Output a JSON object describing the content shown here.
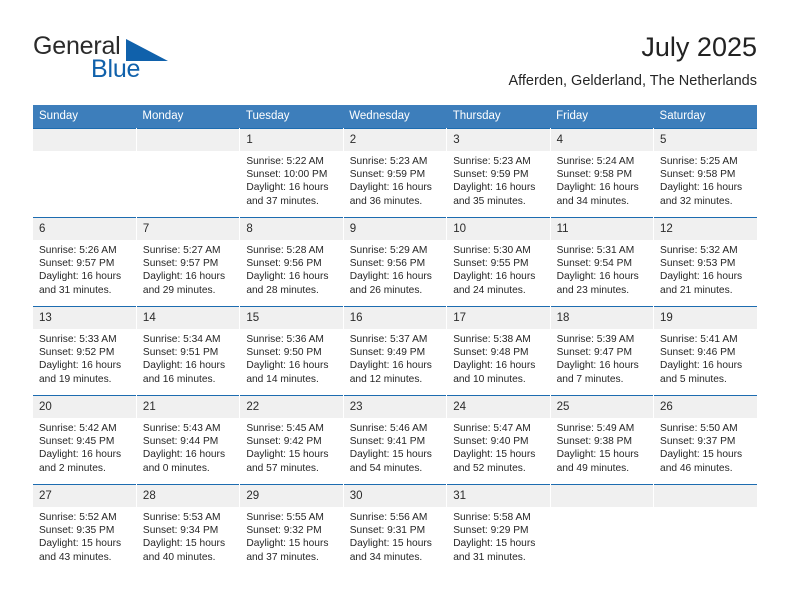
{
  "logo": {
    "word_dark": "General",
    "word_blue": "Blue",
    "triangle_color": "#1061ab",
    "text_color": "#2b2b2b"
  },
  "header": {
    "title": "July 2025",
    "subtitle": "Afferden, Gelderland, The Netherlands"
  },
  "theme": {
    "header_blue": "#3d7ebb",
    "rule_blue": "#1d6cb0",
    "daynum_band": "#f0f0f0",
    "text": "#262626"
  },
  "calendar": {
    "weekday_headers": [
      "Sunday",
      "Monday",
      "Tuesday",
      "Wednesday",
      "Thursday",
      "Friday",
      "Saturday"
    ],
    "weeks": [
      [
        {
          "day": "",
          "sunrise": "",
          "sunset": "",
          "daylight1": "",
          "daylight2": ""
        },
        {
          "day": "",
          "sunrise": "",
          "sunset": "",
          "daylight1": "",
          "daylight2": ""
        },
        {
          "day": "1",
          "sunrise": "Sunrise: 5:22 AM",
          "sunset": "Sunset: 10:00 PM",
          "daylight1": "Daylight: 16 hours",
          "daylight2": "and 37 minutes."
        },
        {
          "day": "2",
          "sunrise": "Sunrise: 5:23 AM",
          "sunset": "Sunset: 9:59 PM",
          "daylight1": "Daylight: 16 hours",
          "daylight2": "and 36 minutes."
        },
        {
          "day": "3",
          "sunrise": "Sunrise: 5:23 AM",
          "sunset": "Sunset: 9:59 PM",
          "daylight1": "Daylight: 16 hours",
          "daylight2": "and 35 minutes."
        },
        {
          "day": "4",
          "sunrise": "Sunrise: 5:24 AM",
          "sunset": "Sunset: 9:58 PM",
          "daylight1": "Daylight: 16 hours",
          "daylight2": "and 34 minutes."
        },
        {
          "day": "5",
          "sunrise": "Sunrise: 5:25 AM",
          "sunset": "Sunset: 9:58 PM",
          "daylight1": "Daylight: 16 hours",
          "daylight2": "and 32 minutes."
        }
      ],
      [
        {
          "day": "6",
          "sunrise": "Sunrise: 5:26 AM",
          "sunset": "Sunset: 9:57 PM",
          "daylight1": "Daylight: 16 hours",
          "daylight2": "and 31 minutes."
        },
        {
          "day": "7",
          "sunrise": "Sunrise: 5:27 AM",
          "sunset": "Sunset: 9:57 PM",
          "daylight1": "Daylight: 16 hours",
          "daylight2": "and 29 minutes."
        },
        {
          "day": "8",
          "sunrise": "Sunrise: 5:28 AM",
          "sunset": "Sunset: 9:56 PM",
          "daylight1": "Daylight: 16 hours",
          "daylight2": "and 28 minutes."
        },
        {
          "day": "9",
          "sunrise": "Sunrise: 5:29 AM",
          "sunset": "Sunset: 9:56 PM",
          "daylight1": "Daylight: 16 hours",
          "daylight2": "and 26 minutes."
        },
        {
          "day": "10",
          "sunrise": "Sunrise: 5:30 AM",
          "sunset": "Sunset: 9:55 PM",
          "daylight1": "Daylight: 16 hours",
          "daylight2": "and 24 minutes."
        },
        {
          "day": "11",
          "sunrise": "Sunrise: 5:31 AM",
          "sunset": "Sunset: 9:54 PM",
          "daylight1": "Daylight: 16 hours",
          "daylight2": "and 23 minutes."
        },
        {
          "day": "12",
          "sunrise": "Sunrise: 5:32 AM",
          "sunset": "Sunset: 9:53 PM",
          "daylight1": "Daylight: 16 hours",
          "daylight2": "and 21 minutes."
        }
      ],
      [
        {
          "day": "13",
          "sunrise": "Sunrise: 5:33 AM",
          "sunset": "Sunset: 9:52 PM",
          "daylight1": "Daylight: 16 hours",
          "daylight2": "and 19 minutes."
        },
        {
          "day": "14",
          "sunrise": "Sunrise: 5:34 AM",
          "sunset": "Sunset: 9:51 PM",
          "daylight1": "Daylight: 16 hours",
          "daylight2": "and 16 minutes."
        },
        {
          "day": "15",
          "sunrise": "Sunrise: 5:36 AM",
          "sunset": "Sunset: 9:50 PM",
          "daylight1": "Daylight: 16 hours",
          "daylight2": "and 14 minutes."
        },
        {
          "day": "16",
          "sunrise": "Sunrise: 5:37 AM",
          "sunset": "Sunset: 9:49 PM",
          "daylight1": "Daylight: 16 hours",
          "daylight2": "and 12 minutes."
        },
        {
          "day": "17",
          "sunrise": "Sunrise: 5:38 AM",
          "sunset": "Sunset: 9:48 PM",
          "daylight1": "Daylight: 16 hours",
          "daylight2": "and 10 minutes."
        },
        {
          "day": "18",
          "sunrise": "Sunrise: 5:39 AM",
          "sunset": "Sunset: 9:47 PM",
          "daylight1": "Daylight: 16 hours",
          "daylight2": "and 7 minutes."
        },
        {
          "day": "19",
          "sunrise": "Sunrise: 5:41 AM",
          "sunset": "Sunset: 9:46 PM",
          "daylight1": "Daylight: 16 hours",
          "daylight2": "and 5 minutes."
        }
      ],
      [
        {
          "day": "20",
          "sunrise": "Sunrise: 5:42 AM",
          "sunset": "Sunset: 9:45 PM",
          "daylight1": "Daylight: 16 hours",
          "daylight2": "and 2 minutes."
        },
        {
          "day": "21",
          "sunrise": "Sunrise: 5:43 AM",
          "sunset": "Sunset: 9:44 PM",
          "daylight1": "Daylight: 16 hours",
          "daylight2": "and 0 minutes."
        },
        {
          "day": "22",
          "sunrise": "Sunrise: 5:45 AM",
          "sunset": "Sunset: 9:42 PM",
          "daylight1": "Daylight: 15 hours",
          "daylight2": "and 57 minutes."
        },
        {
          "day": "23",
          "sunrise": "Sunrise: 5:46 AM",
          "sunset": "Sunset: 9:41 PM",
          "daylight1": "Daylight: 15 hours",
          "daylight2": "and 54 minutes."
        },
        {
          "day": "24",
          "sunrise": "Sunrise: 5:47 AM",
          "sunset": "Sunset: 9:40 PM",
          "daylight1": "Daylight: 15 hours",
          "daylight2": "and 52 minutes."
        },
        {
          "day": "25",
          "sunrise": "Sunrise: 5:49 AM",
          "sunset": "Sunset: 9:38 PM",
          "daylight1": "Daylight: 15 hours",
          "daylight2": "and 49 minutes."
        },
        {
          "day": "26",
          "sunrise": "Sunrise: 5:50 AM",
          "sunset": "Sunset: 9:37 PM",
          "daylight1": "Daylight: 15 hours",
          "daylight2": "and 46 minutes."
        }
      ],
      [
        {
          "day": "27",
          "sunrise": "Sunrise: 5:52 AM",
          "sunset": "Sunset: 9:35 PM",
          "daylight1": "Daylight: 15 hours",
          "daylight2": "and 43 minutes."
        },
        {
          "day": "28",
          "sunrise": "Sunrise: 5:53 AM",
          "sunset": "Sunset: 9:34 PM",
          "daylight1": "Daylight: 15 hours",
          "daylight2": "and 40 minutes."
        },
        {
          "day": "29",
          "sunrise": "Sunrise: 5:55 AM",
          "sunset": "Sunset: 9:32 PM",
          "daylight1": "Daylight: 15 hours",
          "daylight2": "and 37 minutes."
        },
        {
          "day": "30",
          "sunrise": "Sunrise: 5:56 AM",
          "sunset": "Sunset: 9:31 PM",
          "daylight1": "Daylight: 15 hours",
          "daylight2": "and 34 minutes."
        },
        {
          "day": "31",
          "sunrise": "Sunrise: 5:58 AM",
          "sunset": "Sunset: 9:29 PM",
          "daylight1": "Daylight: 15 hours",
          "daylight2": "and 31 minutes."
        },
        {
          "day": "",
          "sunrise": "",
          "sunset": "",
          "daylight1": "",
          "daylight2": ""
        },
        {
          "day": "",
          "sunrise": "",
          "sunset": "",
          "daylight1": "",
          "daylight2": ""
        }
      ]
    ]
  }
}
